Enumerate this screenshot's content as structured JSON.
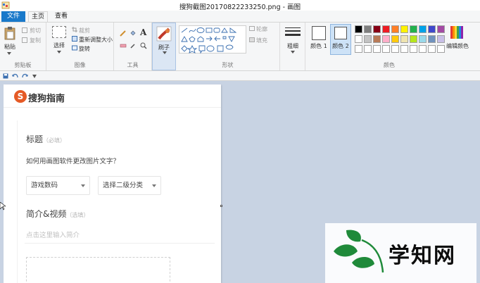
{
  "window": {
    "title": "搜狗截图20170822233250.png - 画图"
  },
  "tabs": [
    {
      "label": "文件"
    },
    {
      "label": "主页"
    },
    {
      "label": "查看"
    }
  ],
  "ribbon": {
    "clipboard": {
      "paste": "粘贴",
      "cut": "剪切",
      "copy": "复制",
      "group": "剪贴板"
    },
    "image": {
      "select": "选择",
      "crop": "裁剪",
      "resize": "重新调整大小",
      "rotate": "旋转",
      "group": "图像"
    },
    "tools": {
      "group": "工具"
    },
    "brushes": {
      "label": "刷子"
    },
    "shapes": {
      "outline": "轮廓",
      "fill": "填充",
      "group": "形状"
    },
    "size": {
      "label": "粗细"
    },
    "colors": {
      "color1": "颜色 1",
      "color2": "颜色 2",
      "edit": "编辑颜色",
      "group": "颜色",
      "palette_row1": [
        "#000000",
        "#7f7f7f",
        "#880015",
        "#ed1c24",
        "#ff7f27",
        "#fff200",
        "#22b14c",
        "#00a2e8",
        "#3f48cc",
        "#a349a4"
      ],
      "palette_row2": [
        "#ffffff",
        "#c3c3c3",
        "#b97a57",
        "#ffaec9",
        "#ffc90e",
        "#efe4b0",
        "#b5e61d",
        "#99d9ea",
        "#7092be",
        "#c8bfe7"
      ]
    }
  },
  "document": {
    "brand": "搜狗指南",
    "title_label": "标题",
    "title_hint": "（必填）",
    "question": "如何用画图软件更改图片文字？",
    "select1": "游戏数码",
    "select2": "选择二级分类",
    "intro_label": "简介&视频",
    "intro_hint": "（选填）",
    "intro_placeholder": "点击这里输入简介"
  },
  "watermark": {
    "text": "学知网"
  }
}
